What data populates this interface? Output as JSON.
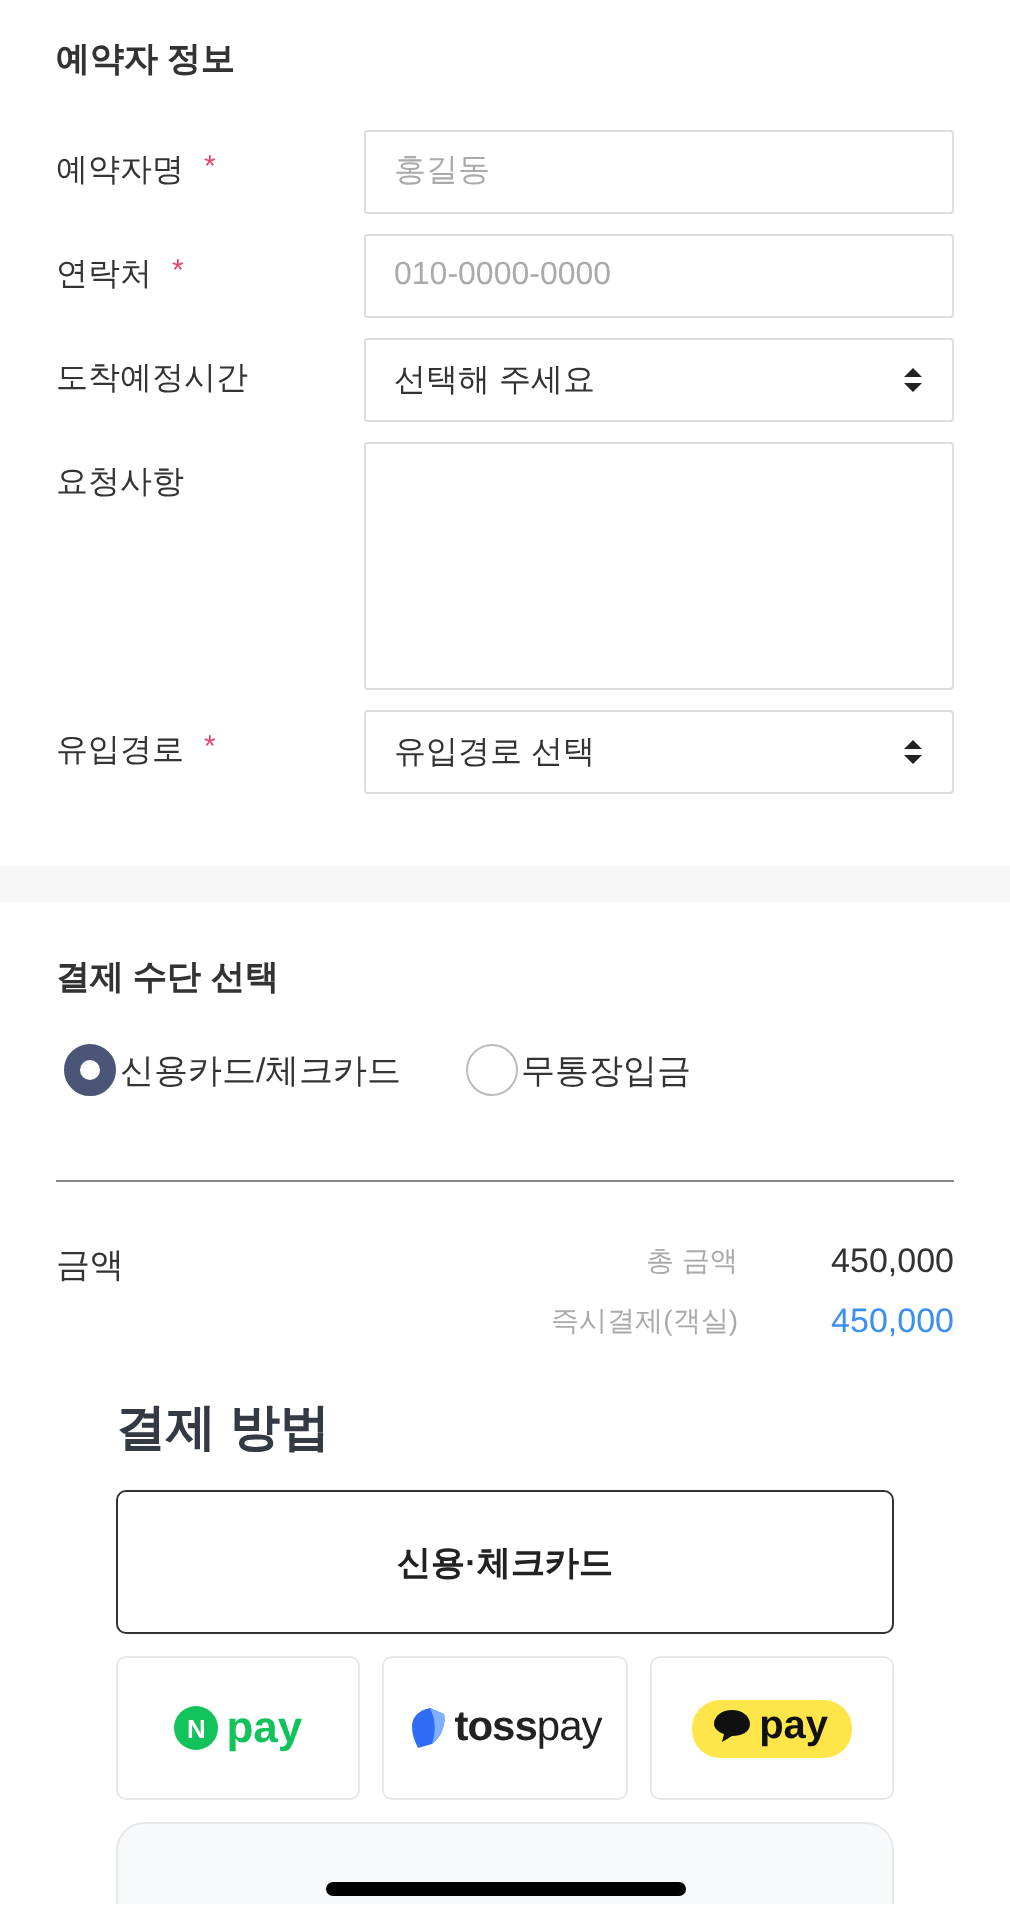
{
  "reservation": {
    "title": "예약자 정보",
    "fields": [
      {
        "kind": "text",
        "label": "예약자명",
        "required_mark": "*",
        "placeholder": "홍길동"
      },
      {
        "kind": "text",
        "label": "연락처",
        "required_mark": "*",
        "placeholder": "010-0000-0000"
      },
      {
        "kind": "select",
        "label": "도착예정시간",
        "value": "선택해 주세요"
      },
      {
        "kind": "textarea",
        "label": "요청사항"
      },
      {
        "kind": "select",
        "label": "유입경로",
        "required_mark": "*",
        "value": "유입경로 선택"
      }
    ]
  },
  "payment_type": {
    "title": "결제 수단 선택",
    "options": [
      {
        "label": "신용카드/체크카드",
        "selected": true
      },
      {
        "label": "무통장입금",
        "selected": false
      }
    ]
  },
  "amount": {
    "label": "금액",
    "lines": [
      {
        "kind": "total",
        "label": "총 금액",
        "value": "450,000"
      },
      {
        "kind": "due",
        "label": "즉시결제(객실)",
        "value": "450,000"
      }
    ]
  },
  "payment_method": {
    "title": "결제 방법",
    "options": [
      {
        "kind": "card",
        "label": "신용·체크카드",
        "selected": true
      },
      {
        "kind": "naver",
        "badge": "N",
        "label": "pay",
        "selected": false
      },
      {
        "kind": "toss",
        "label": "toss",
        "suffix": "pay",
        "selected": false
      },
      {
        "kind": "kakao",
        "label": "pay",
        "selected": false
      }
    ]
  }
}
